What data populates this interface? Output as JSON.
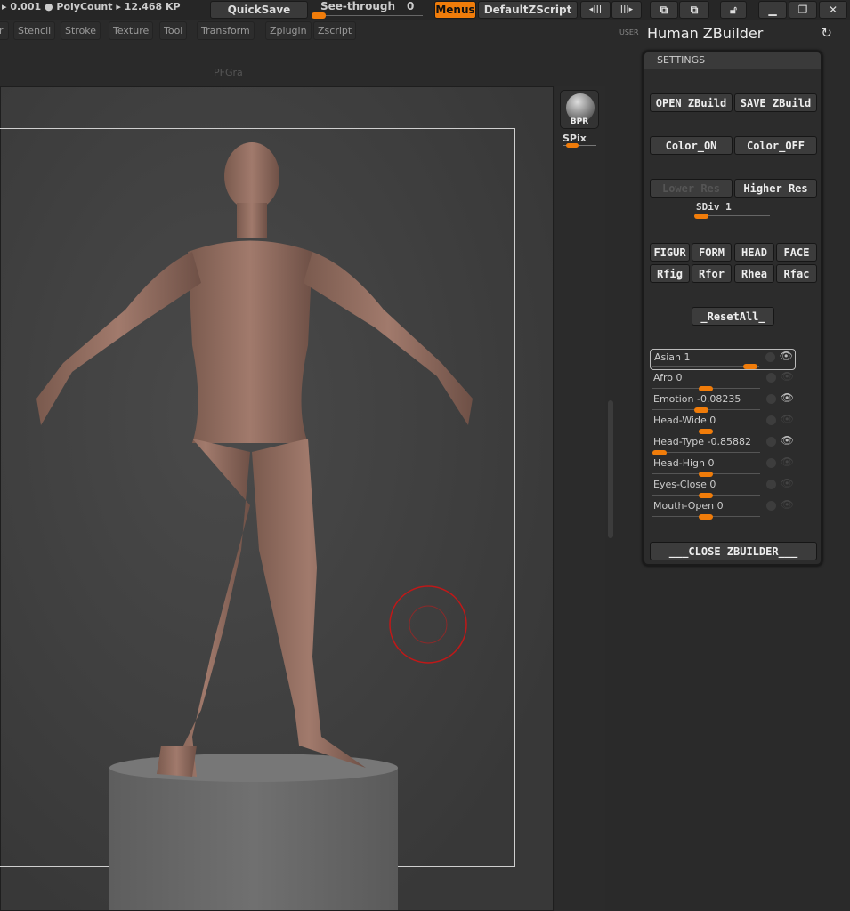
{
  "topbar": {
    "stats": "▸ 0.001 ● PolyCount ▸ 12.468 KP",
    "quicksave": "QuickSave",
    "see_through_label": "See-through",
    "see_through_value": "0",
    "menus": "Menus",
    "default_zscript": "DefaultZScript",
    "accent": "#f07c0a"
  },
  "menus": [
    "r",
    "Stencil",
    "Stroke",
    "Texture",
    "Tool",
    "Transform",
    "Zplugin",
    "Zscript"
  ],
  "canvas": {
    "doc_label": "PFGra"
  },
  "shelf": {
    "bpr": "BPR",
    "spix": "SPix"
  },
  "right_panel": {
    "user": "USER",
    "title": "Human ZBuilder",
    "settings": "SETTINGS",
    "open": "OPEN ZBuild",
    "save": "SAVE ZBuild",
    "color_on": "Color_ON",
    "color_off": "Color_OFF",
    "lower_res": "Lower Res",
    "higher_res": "Higher Res",
    "sdiv": "SDiv 1",
    "presets": [
      "FIGUR",
      "FORM",
      "HEAD",
      "FACE",
      "Rfig",
      "Rfor",
      "Rhea",
      "Rfac"
    ],
    "reset": "_ResetAll_",
    "sliders": [
      {
        "label": "Asian",
        "value": "1",
        "pos": 0.9,
        "eye": true,
        "selected": true
      },
      {
        "label": "Afro",
        "value": "0",
        "pos": 0.5,
        "eye": false
      },
      {
        "label": "Emotion",
        "value": "-0.08235",
        "pos": 0.46,
        "eye": true
      },
      {
        "label": "Head-Wide",
        "value": "0",
        "pos": 0.5,
        "eye": false
      },
      {
        "label": "Head-Type",
        "value": "-0.85882",
        "pos": 0.07,
        "eye": true
      },
      {
        "label": "Head-High",
        "value": "0",
        "pos": 0.5,
        "eye": false
      },
      {
        "label": "Eyes-Close",
        "value": "0",
        "pos": 0.5,
        "eye": false
      },
      {
        "label": "Mouth-Open",
        "value": "0",
        "pos": 0.5,
        "eye": false
      }
    ],
    "close": "___CLOSE ZBUILDER___"
  }
}
